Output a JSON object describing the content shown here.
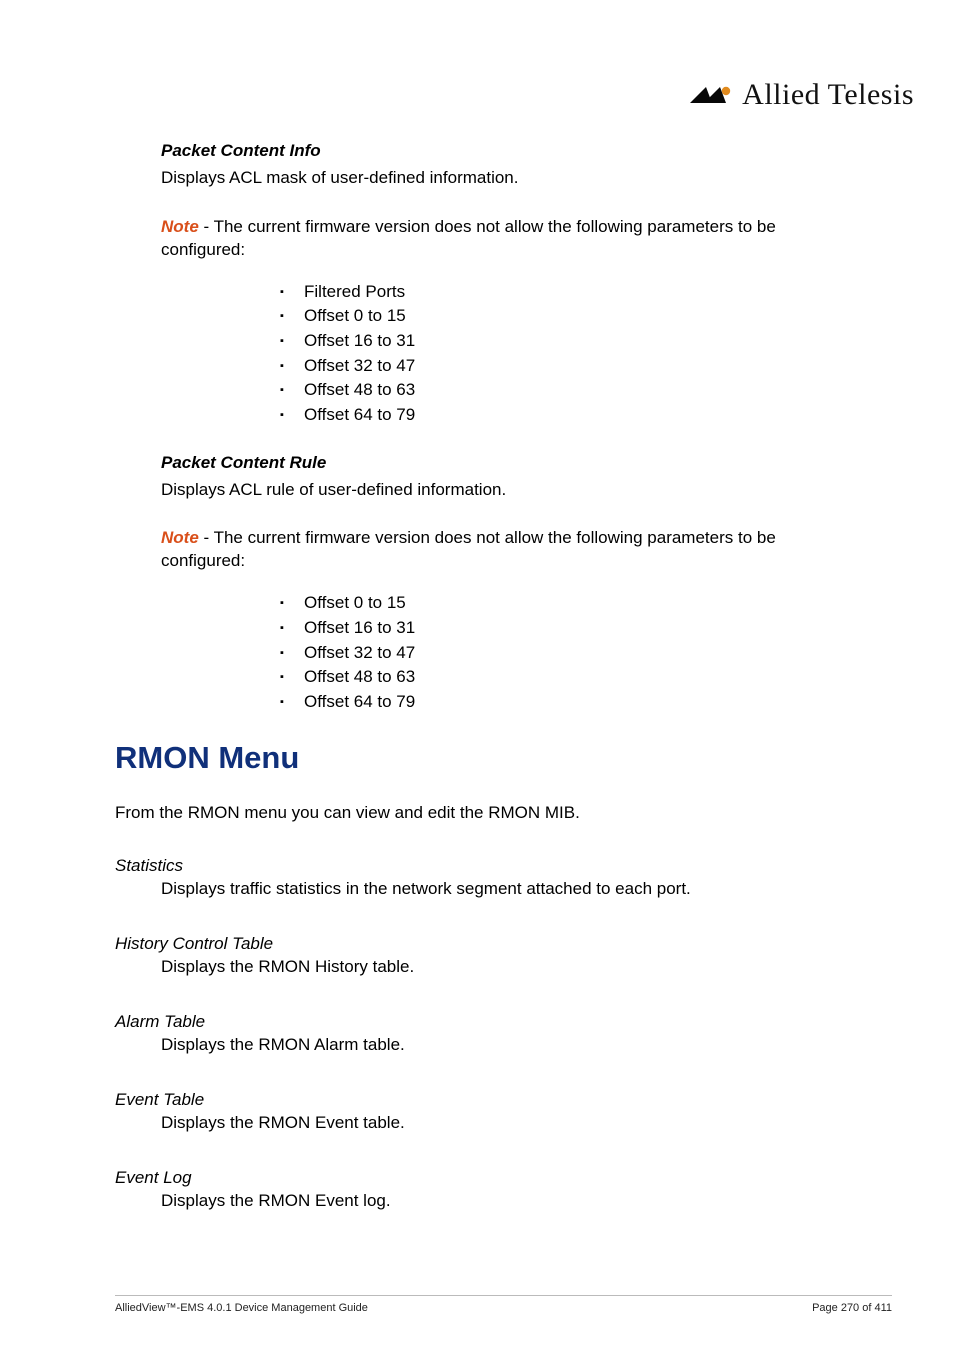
{
  "brand": {
    "text": "Allied Telesis"
  },
  "section1": {
    "title": "Packet Content Info",
    "desc": "Displays ACL mask of user-defined information.",
    "note_prefix": "Note",
    "note_body": " - The current firmware version does not allow the following parameters to be configured:",
    "bullets": [
      "Filtered Ports",
      "Offset 0 to 15",
      "Offset 16 to 31",
      "Offset 32 to 47",
      "Offset 48 to 63",
      "Offset 64 to 79"
    ]
  },
  "section2": {
    "title": "Packet Content Rule",
    "desc": "Displays ACL rule of user-defined information.",
    "note_prefix": "Note",
    "note_body": " - The current firmware version does not allow the following parameters to be configured:",
    "bullets": [
      "Offset 0 to 15",
      "Offset 16 to 31",
      "Offset 32 to 47",
      "Offset 48 to 63",
      "Offset 64 to 79"
    ]
  },
  "rmon": {
    "heading": "RMON Menu",
    "intro": "From the RMON menu you can view and edit the RMON MIB.",
    "defs": [
      {
        "term": "Statistics",
        "desc": "Displays traffic statistics in the network segment attached to each port."
      },
      {
        "term": "History Control Table",
        "desc": "Displays the RMON History table."
      },
      {
        "term": "Alarm Table",
        "desc": "Displays the RMON Alarm table."
      },
      {
        "term": "Event Table",
        "desc": "Displays the RMON Event table."
      },
      {
        "term": "Event Log",
        "desc": "Displays the RMON Event log."
      }
    ]
  },
  "footer": {
    "left": "AlliedView™-EMS 4.0.1 Device Management Guide",
    "right": "Page 270 of 411"
  }
}
